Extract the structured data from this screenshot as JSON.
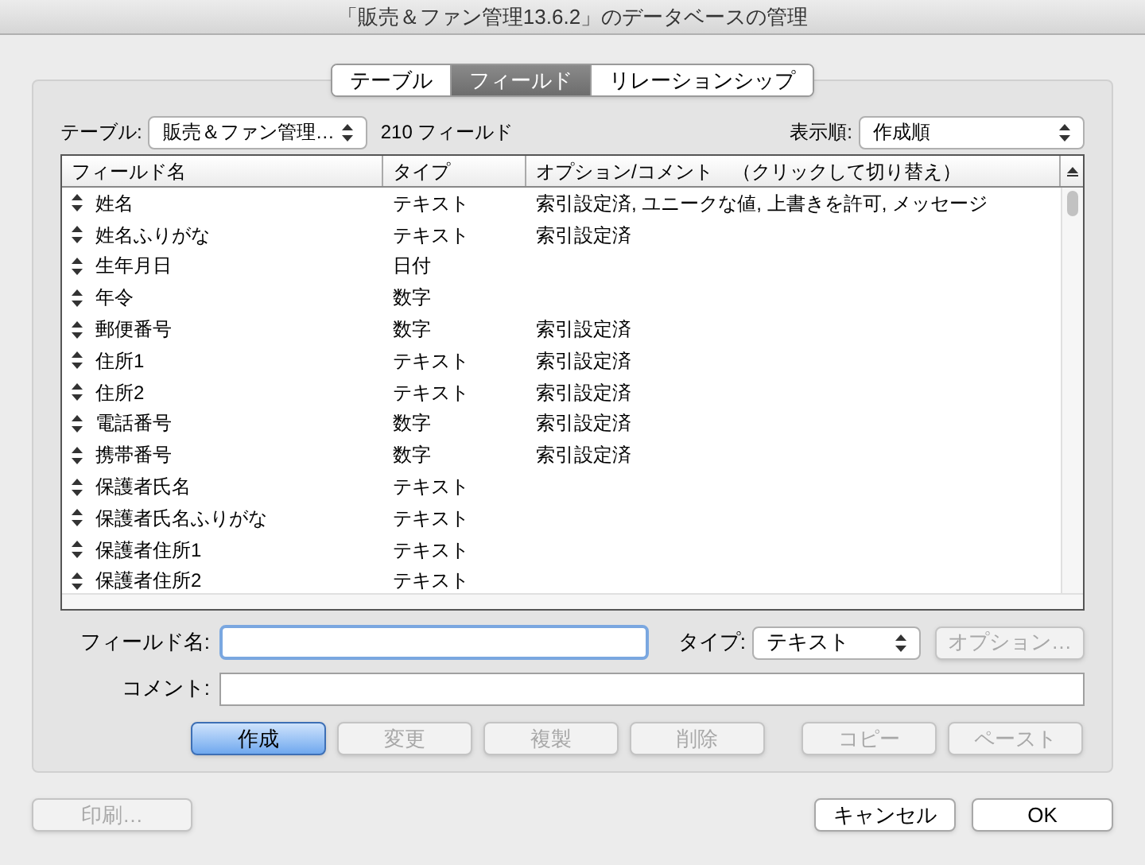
{
  "window": {
    "title": "「販売＆ファン管理13.6.2」のデータベースの管理"
  },
  "tabs": [
    {
      "label": "テーブル",
      "selected": false
    },
    {
      "label": "フィールド",
      "selected": true
    },
    {
      "label": "リレーションシップ",
      "selected": false
    }
  ],
  "table_selector": {
    "label": "テーブル:",
    "value": "販売＆ファン管理…",
    "count": "210 フィールド"
  },
  "sort_selector": {
    "label": "表示順:",
    "value": "作成順"
  },
  "table": {
    "columns": [
      "フィールド名",
      "タイプ",
      "オプション/コメント　（クリックして切り替え）"
    ],
    "rows": [
      {
        "name": "姓名",
        "type": "テキスト",
        "options": "索引設定済, ユニークな値, 上書きを許可, メッセージ"
      },
      {
        "name": "姓名ふりがな",
        "type": "テキスト",
        "options": "索引設定済"
      },
      {
        "name": "生年月日",
        "type": "日付",
        "options": ""
      },
      {
        "name": "年令",
        "type": "数字",
        "options": ""
      },
      {
        "name": "郵便番号",
        "type": "数字",
        "options": "索引設定済"
      },
      {
        "name": "住所1",
        "type": "テキスト",
        "options": "索引設定済"
      },
      {
        "name": "住所2",
        "type": "テキスト",
        "options": "索引設定済"
      },
      {
        "name": "電話番号",
        "type": "数字",
        "options": "索引設定済"
      },
      {
        "name": "携帯番号",
        "type": "数字",
        "options": "索引設定済"
      },
      {
        "name": "保護者氏名",
        "type": "テキスト",
        "options": ""
      },
      {
        "name": "保護者氏名ふりがな",
        "type": "テキスト",
        "options": ""
      },
      {
        "name": "保護者住所1",
        "type": "テキスト",
        "options": ""
      },
      {
        "name": "保護者住所2",
        "type": "テキスト",
        "options": ""
      }
    ]
  },
  "field_name": {
    "label": "フィールド名:"
  },
  "field_type": {
    "label": "タイプ:",
    "value": "テキスト"
  },
  "options_button": {
    "label": "オプション…",
    "disabled": true
  },
  "comment": {
    "label": "コメント:"
  },
  "action_buttons": [
    {
      "label": "作成",
      "disabled": false,
      "default": true
    },
    {
      "label": "変更",
      "disabled": true,
      "default": false
    },
    {
      "label": "複製",
      "disabled": true,
      "default": false
    },
    {
      "label": "削除",
      "disabled": true,
      "default": false
    }
  ],
  "clipboard_buttons": [
    {
      "label": "コピー",
      "disabled": true
    },
    {
      "label": "ペースト",
      "disabled": true
    }
  ],
  "print_button": {
    "label": "印刷…",
    "disabled": true
  },
  "dialog_buttons": [
    {
      "label": "キャンセル"
    },
    {
      "label": "OK"
    }
  ]
}
